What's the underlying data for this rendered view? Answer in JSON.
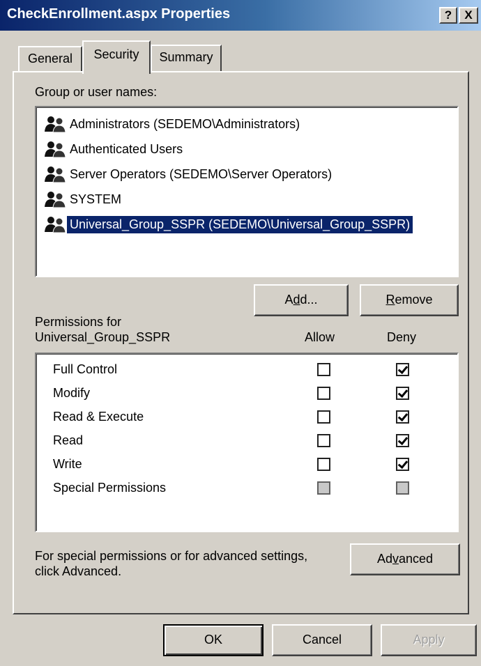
{
  "window": {
    "title": "CheckEnrollment.aspx Properties",
    "help_label": "?",
    "close_label": "X"
  },
  "tabs": [
    {
      "label": "General",
      "active": false
    },
    {
      "label": "Security",
      "active": true
    },
    {
      "label": "Summary",
      "active": false
    }
  ],
  "group_list": {
    "label": "Group or user names:",
    "items": [
      {
        "label": "Administrators (SEDEMO\\Administrators)",
        "icon": "group-icon",
        "selected": false
      },
      {
        "label": "Authenticated Users",
        "icon": "group-icon",
        "selected": false
      },
      {
        "label": "Server Operators (SEDEMO\\Server Operators)",
        "icon": "group-icon",
        "selected": false
      },
      {
        "label": "SYSTEM",
        "icon": "group-icon",
        "selected": false
      },
      {
        "label": "Universal_Group_SSPR (SEDEMO\\Universal_Group_SSPR)",
        "icon": "group-icon",
        "selected": true
      }
    ]
  },
  "buttons": {
    "add": {
      "pre": "A",
      "ul": "d",
      "post": "d..."
    },
    "remove": {
      "pre": "",
      "ul": "R",
      "post": "emove"
    },
    "advanced": {
      "pre": "Ad",
      "ul": "v",
      "post": "anced"
    },
    "ok": "OK",
    "cancel": "Cancel",
    "apply": "Apply"
  },
  "permissions": {
    "label_line1": "Permissions for",
    "label_line2": "Universal_Group_SSPR",
    "allow_header": "Allow",
    "deny_header": "Deny",
    "rows": [
      {
        "name": "Full Control",
        "allow": false,
        "deny": true,
        "enabled": true
      },
      {
        "name": "Modify",
        "allow": false,
        "deny": true,
        "enabled": true
      },
      {
        "name": "Read & Execute",
        "allow": false,
        "deny": true,
        "enabled": true
      },
      {
        "name": "Read",
        "allow": false,
        "deny": true,
        "enabled": true
      },
      {
        "name": "Write",
        "allow": false,
        "deny": true,
        "enabled": true
      },
      {
        "name": "Special Permissions",
        "allow": false,
        "deny": false,
        "enabled": false
      }
    ]
  },
  "advanced_text": {
    "line1": "For special permissions or for advanced settings,",
    "line2": "click Advanced."
  },
  "colors": {
    "title_gradient_start": "#0a246a",
    "selection": "#0a246a",
    "face": "#d4d0c8"
  }
}
